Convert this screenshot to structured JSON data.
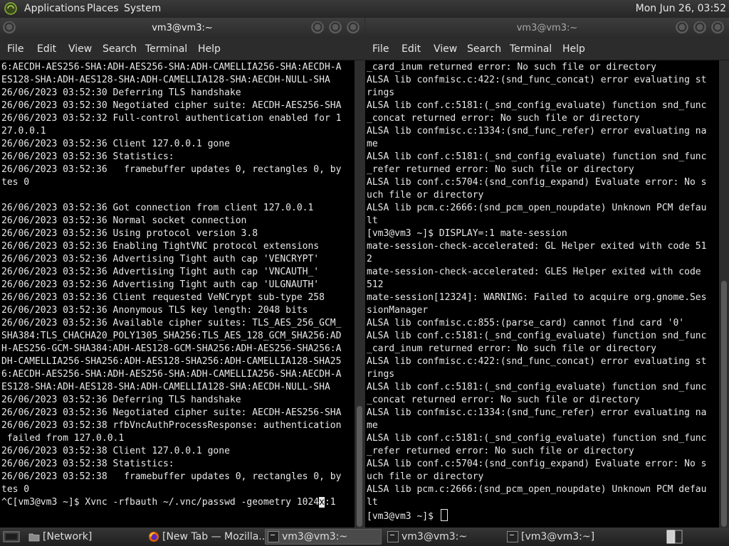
{
  "top_panel": {
    "menus": [
      "Applications",
      "Places",
      "System"
    ],
    "clock": "Mon Jun 26, 03:52"
  },
  "left_window": {
    "title": "vm3@vm3:~",
    "menus": [
      "File",
      "Edit",
      "View",
      "Search",
      "Terminal",
      "Help"
    ],
    "lines": [
      "6:AECDH-AES256-SHA:ADH-AES256-SHA:ADH-CAMELLIA256-SHA:AECDH-A",
      "ES128-SHA:ADH-AES128-SHA:ADH-CAMELLIA128-SHA:AECDH-NULL-SHA",
      "26/06/2023 03:52:30 Deferring TLS handshake",
      "26/06/2023 03:52:30 Negotiated cipher suite: AECDH-AES256-SHA",
      "26/06/2023 03:52:32 Full-control authentication enabled for 1",
      "27.0.0.1",
      "26/06/2023 03:52:36 Client 127.0.0.1 gone",
      "26/06/2023 03:52:36 Statistics:",
      "26/06/2023 03:52:36   framebuffer updates 0, rectangles 0, by",
      "tes 0",
      "",
      "26/06/2023 03:52:36 Got connection from client 127.0.0.1",
      "26/06/2023 03:52:36 Normal socket connection",
      "26/06/2023 03:52:36 Using protocol version 3.8",
      "26/06/2023 03:52:36 Enabling TightVNC protocol extensions",
      "26/06/2023 03:52:36 Advertising Tight auth cap 'VENCRYPT'",
      "26/06/2023 03:52:36 Advertising Tight auth cap 'VNCAUTH_'",
      "26/06/2023 03:52:36 Advertising Tight auth cap 'ULGNAUTH'",
      "26/06/2023 03:52:36 Client requested VeNCrypt sub-type 258",
      "26/06/2023 03:52:36 Anonymous TLS key length: 2048 bits",
      "26/06/2023 03:52:36 Available cipher suites: TLS_AES_256_GCM_",
      "SHA384:TLS_CHACHA20_POLY1305_SHA256:TLS_AES_128_GCM_SHA256:AD",
      "H-AES256-GCM-SHA384:ADH-AES128-GCM-SHA256:ADH-AES256-SHA256:A",
      "DH-CAMELLIA256-SHA256:ADH-AES128-SHA256:ADH-CAMELLIA128-SHA25",
      "6:AECDH-AES256-SHA:ADH-AES256-SHA:ADH-CAMELLIA256-SHA:AECDH-A",
      "ES128-SHA:ADH-AES128-SHA:ADH-CAMELLIA128-SHA:AECDH-NULL-SHA",
      "26/06/2023 03:52:36 Deferring TLS handshake",
      "26/06/2023 03:52:36 Negotiated cipher suite: AECDH-AES256-SHA",
      "26/06/2023 03:52:38 rfbVncAuthProcessResponse: authentication",
      " failed from 127.0.0.1",
      "26/06/2023 03:52:38 Client 127.0.0.1 gone",
      "26/06/2023 03:52:38 Statistics:",
      "26/06/2023 03:52:38   framebuffer updates 0, rectangles 0, by",
      "tes 0"
    ],
    "prompt_before_cursor": "^C[vm3@vm3 ~]$ Xvnc -rfbauth ~/.vnc/passwd -geometry 1024",
    "prompt_cursor_char": "x",
    "prompt_after_cursor": ":1"
  },
  "right_window": {
    "title": "vm3@vm3:~",
    "menus": [
      "File",
      "Edit",
      "View",
      "Search",
      "Terminal",
      "Help"
    ],
    "lines": [
      "_card_inum returned error: No such file or directory",
      "ALSA lib confmisc.c:422:(snd_func_concat) error evaluating st",
      "rings",
      "ALSA lib conf.c:5181:(_snd_config_evaluate) function snd_func",
      "_concat returned error: No such file or directory",
      "ALSA lib confmisc.c:1334:(snd_func_refer) error evaluating na",
      "me",
      "ALSA lib conf.c:5181:(_snd_config_evaluate) function snd_func",
      "_refer returned error: No such file or directory",
      "ALSA lib conf.c:5704:(snd_config_expand) Evaluate error: No s",
      "uch file or directory",
      "ALSA lib pcm.c:2666:(snd_pcm_open_noupdate) Unknown PCM defau",
      "lt",
      "[vm3@vm3 ~]$ DISPLAY=:1 mate-session",
      "mate-session-check-accelerated: GL Helper exited with code 51",
      "2",
      "mate-session-check-accelerated: GLES Helper exited with code",
      "512",
      "mate-session[12324]: WARNING: Failed to acquire org.gnome.Ses",
      "sionManager",
      "ALSA lib confmisc.c:855:(parse_card) cannot find card '0'",
      "ALSA lib conf.c:5181:(_snd_config_evaluate) function snd_func",
      "_card_inum returned error: No such file or directory",
      "ALSA lib confmisc.c:422:(snd_func_concat) error evaluating st",
      "rings",
      "ALSA lib conf.c:5181:(_snd_config_evaluate) function snd_func",
      "_concat returned error: No such file or directory",
      "ALSA lib confmisc.c:1334:(snd_func_refer) error evaluating na",
      "me",
      "ALSA lib conf.c:5181:(_snd_config_evaluate) function snd_func",
      "_refer returned error: No such file or directory",
      "ALSA lib conf.c:5704:(snd_config_expand) Evaluate error: No s",
      "uch file or directory",
      "ALSA lib pcm.c:2666:(snd_pcm_open_noupdate) Unknown PCM defau",
      "lt"
    ],
    "prompt": "[vm3@vm3 ~]$ "
  },
  "taskbar": {
    "items": [
      {
        "label": "[Network]",
        "icon": "folder-icon",
        "active": false
      },
      {
        "label": "[New Tab — Mozilla...",
        "icon": "firefox-icon",
        "active": false
      },
      {
        "label": "vm3@vm3:~",
        "icon": "terminal-icon",
        "active": true
      },
      {
        "label": "vm3@vm3:~",
        "icon": "terminal-icon",
        "active": false
      },
      {
        "label": "[vm3@vm3:~]",
        "icon": "terminal-icon",
        "active": false
      }
    ]
  }
}
